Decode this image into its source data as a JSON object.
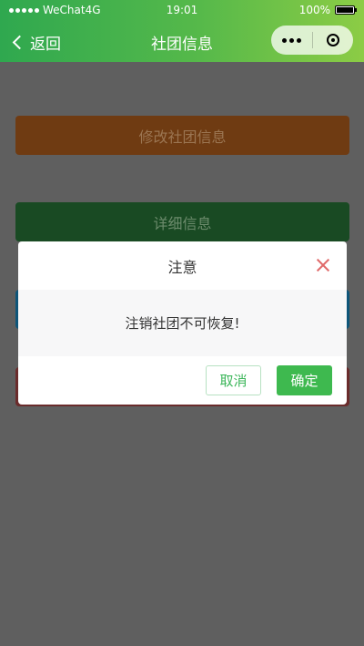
{
  "status_bar": {
    "carrier": "WeChat4G",
    "time": "19:01",
    "battery": "100%"
  },
  "nav": {
    "back_label": "返回",
    "title": "社团信息"
  },
  "page": {
    "buttons": [
      {
        "label": "修改社团信息"
      },
      {
        "label": "详细信息"
      }
    ]
  },
  "modal": {
    "title": "注意",
    "message": "注销社团不可恢复!",
    "cancel_label": "取消",
    "confirm_label": "确定"
  },
  "colors": {
    "brand_green": "#3eb94f",
    "close_icon": "#e06a6a"
  }
}
